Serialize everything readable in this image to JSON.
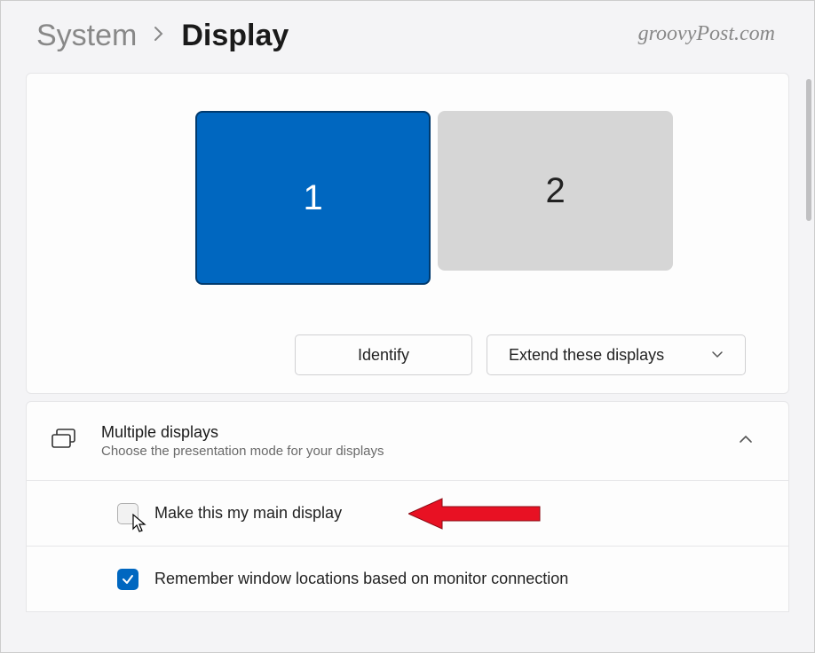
{
  "breadcrumb": {
    "parent": "System",
    "current": "Display"
  },
  "watermark": "groovyPost.com",
  "monitors": [
    {
      "label": "1",
      "selected": true
    },
    {
      "label": "2",
      "selected": false
    }
  ],
  "buttons": {
    "identify": "Identify",
    "extend": "Extend these displays"
  },
  "section": {
    "title": "Multiple displays",
    "subtitle": "Choose the presentation mode for your displays"
  },
  "options": {
    "main_display": "Make this my main display",
    "remember_windows": "Remember window locations based on monitor connection"
  }
}
